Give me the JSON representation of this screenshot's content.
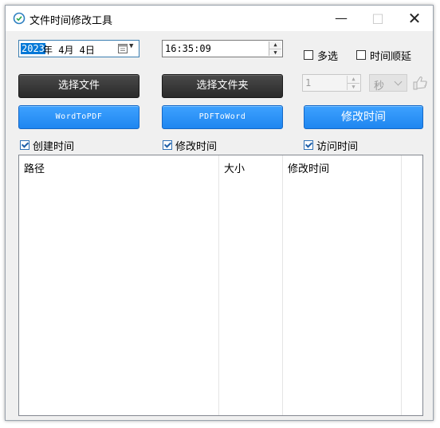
{
  "window": {
    "title": "文件时间修改工具"
  },
  "date_picker": {
    "year": "2023",
    "rest": "年  4月  4日"
  },
  "time_picker": {
    "value": "16:35:09"
  },
  "options": {
    "multi_select_label": "多选",
    "multi_select_checked": false,
    "time_sequence_label": "时间顺延",
    "time_sequence_checked": false
  },
  "buttons": {
    "select_file": "选择文件",
    "select_folder": "选择文件夹",
    "word_to_pdf": "WordToPDF",
    "pdf_to_word": "PDFToWord",
    "modify_time": "修改时间"
  },
  "interval": {
    "value": "1",
    "unit": "秒"
  },
  "time_types": {
    "created": {
      "label": "创建时间",
      "checked": true
    },
    "modified": {
      "label": "修改时间",
      "checked": true
    },
    "accessed": {
      "label": "访问时间",
      "checked": true
    }
  },
  "file_list": {
    "columns": [
      "路径",
      "大小",
      "修改时间"
    ],
    "rows": []
  },
  "colors": {
    "accent_blue": "#1e86f0",
    "dark_button": "#2f2f2f",
    "selection": "#0078d7"
  }
}
